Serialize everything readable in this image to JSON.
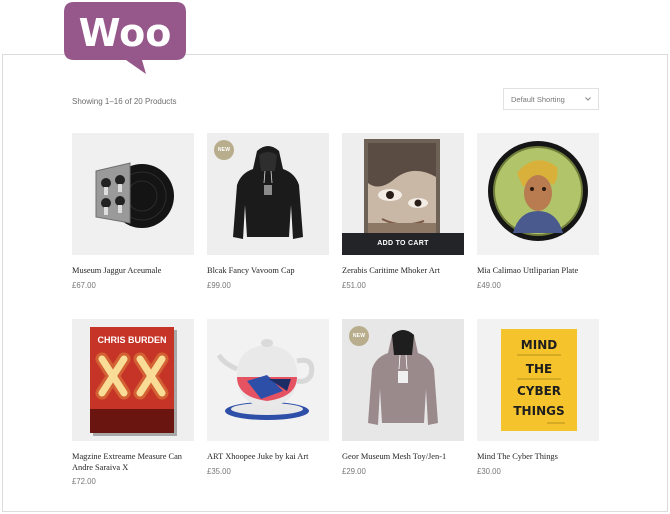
{
  "brand": {
    "logo_text": "Woo",
    "logo_color": "#96588a"
  },
  "toolbar": {
    "result_count": "Showing 1–16 of 20 Products",
    "sort_selected": "Default Shorting"
  },
  "colors": {
    "badge": "#b8ad8c",
    "button": "#222427",
    "thumb_bg": "#eeeeee"
  },
  "products": [
    {
      "name": "Museum Jaggur Aceumale",
      "price": "£67.00",
      "badge": "",
      "button": "",
      "image": "vinyl-record"
    },
    {
      "name": "Blcak Fancy Vavoom Cap",
      "price": "£99.00",
      "badge": "NEW",
      "button": "",
      "image": "black-hoodie"
    },
    {
      "name": "Zerabis Caritime Mhoker Art",
      "price": "£51.00",
      "badge": "",
      "button": "ADD TO CART",
      "image": "face-painting"
    },
    {
      "name": "Mia Calimao Uttliparian Plate",
      "price": "£49.00",
      "badge": "",
      "button": "",
      "image": "portrait-plate"
    },
    {
      "name": "Magzine Extreame Measure Can Andre Saraiva X",
      "price": "£72.00",
      "badge": "",
      "button": "",
      "image": "chris-burden-book",
      "cover_title": "CHRIS BURDEN"
    },
    {
      "name": "ART Xhoopee Juke by kai Art",
      "price": "£35.00",
      "badge": "",
      "button": "",
      "image": "teapot"
    },
    {
      "name": "Geor Museum Mesh Toy/Jen-1",
      "price": "£29.00",
      "badge": "NEW",
      "button": "",
      "image": "grey-hoodie"
    },
    {
      "name": "Mind The Cyber Things",
      "price": "£30.00",
      "badge": "",
      "button": "",
      "image": "mind-cyber-book",
      "cover_lines": [
        "MIND",
        "THE",
        "CYBER",
        "THINGS"
      ]
    }
  ]
}
